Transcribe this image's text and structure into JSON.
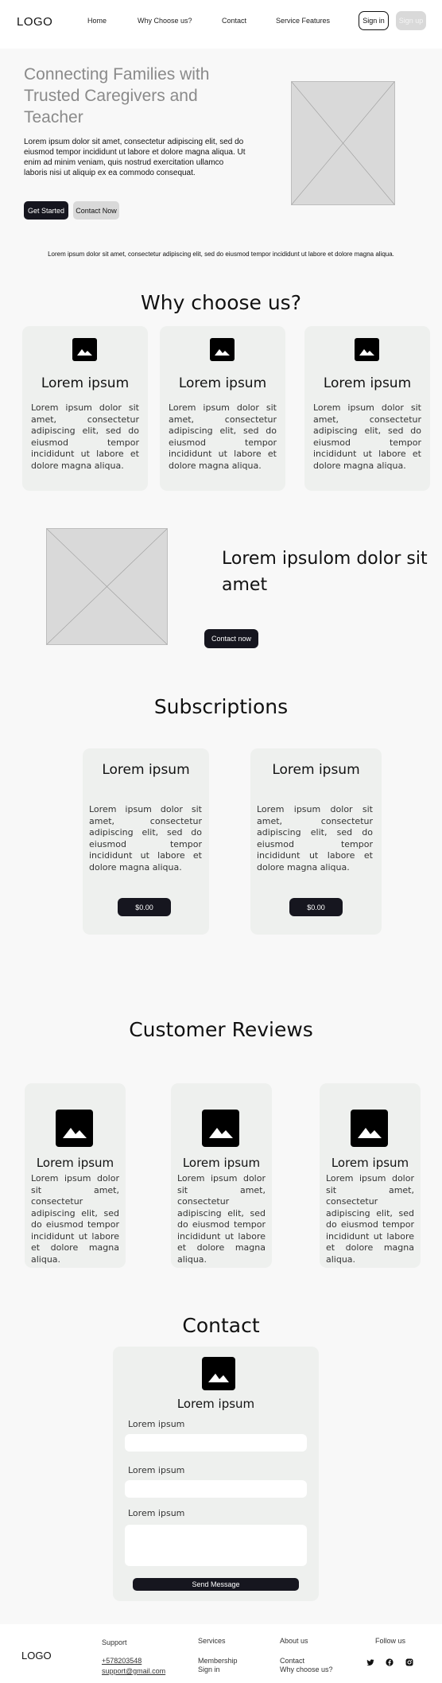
{
  "header": {
    "logo": "LOGO",
    "nav": [
      "Home",
      "Why Choose us?",
      "Contact",
      "Service Features"
    ],
    "signin_label": "Sign in",
    "signup_label": "Sign up"
  },
  "hero": {
    "title": "Connecting Families with Trusted Caregivers and Teacher",
    "text": "Lorem ipsum dolor sit amet, consectetur adipiscing elit, sed do eiusmod tempor incididunt ut labore et dolore magna aliqua. Ut enim ad minim veniam, quis nostrud exercitation ullamco laboris nisi ut aliquip ex ea commodo consequat.",
    "get_started_label": "Get Started",
    "contact_now_label": "Contact Now",
    "caption": "Lorem ipsum dolor sit amet, consectetur adipiscing elit, sed do eiusmod tempor incididunt ut labore et dolore magna aliqua."
  },
  "why": {
    "heading": "Why choose us?",
    "cards": [
      {
        "title": "Lorem ipsum",
        "text": "Lorem ipsum dolor sit amet, consectetur adipiscing elit, sed do eiusmod tempor incididunt ut labore et dolore magna aliqua."
      },
      {
        "title": "Lorem ipsum",
        "text": "Lorem ipsum dolor sit amet, consectetur adipiscing elit, sed do eiusmod tempor incididunt ut labore et dolore magna aliqua."
      },
      {
        "title": "Lorem ipsum",
        "text": "Lorem ipsum dolor sit amet, consectetur adipiscing elit, sed do eiusmod tempor incididunt ut labore et dolore magna aliqua."
      }
    ]
  },
  "feature": {
    "title": "Lorem ipsulom dolor sit amet",
    "button_label": "Contact now"
  },
  "subscriptions": {
    "heading": "Subscriptions",
    "cards": [
      {
        "title": "Lorem ipsum",
        "text": "Lorem ipsum dolor sit amet, consectetur adipiscing elit, sed do eiusmod tempor incididunt ut labore et dolore magna aliqua.",
        "price": "$0.00"
      },
      {
        "title": "Lorem ipsum",
        "text": "Lorem ipsum dolor sit amet, consectetur adipiscing elit, sed do eiusmod tempor incididunt ut labore et dolore magna aliqua.",
        "price": "$0.00"
      }
    ]
  },
  "reviews": {
    "heading": "Customer Reviews",
    "cards": [
      {
        "title": "Lorem ipsum",
        "text": "Lorem ipsum dolor sit amet, consectetur adipiscing elit, sed do eiusmod tempor incididunt ut labore et dolore magna aliqua."
      },
      {
        "title": "Lorem ipsum",
        "text": "Lorem ipsum dolor sit amet, consectetur adipiscing elit, sed do eiusmod tempor incididunt ut labore et dolore magna aliqua."
      },
      {
        "title": "Lorem ipsum",
        "text": "Lorem ipsum dolor sit amet, consectetur adipiscing elit, sed do eiusmod tempor incididunt ut labore et dolore magna aliqua."
      }
    ]
  },
  "contact": {
    "heading": "Contact",
    "subtitle": "Lorem ipsum",
    "fields": [
      {
        "label": "Lorem ipsum",
        "value": ""
      },
      {
        "label": "Lorem ipsum",
        "value": ""
      },
      {
        "label": "Lorem ipsum",
        "value": ""
      }
    ],
    "send_label": "Send Message"
  },
  "footer": {
    "logo": "LOGO",
    "support": {
      "heading": "Support",
      "phone": "+578203548",
      "email": "support@gmail.com"
    },
    "services": {
      "heading": "Services",
      "links": [
        "Membership",
        "Sign in"
      ]
    },
    "about": {
      "heading": "About us",
      "links": [
        "Contact",
        "Why choose us?"
      ]
    },
    "follow": {
      "heading": "Follow us",
      "icons": [
        "twitter-icon",
        "facebook-icon",
        "instagram-icon"
      ]
    }
  },
  "colors": {
    "primary_dark": "#16161f",
    "card_bg": "#eef0ee",
    "placeholder": "#d9d9d9",
    "page_bg": "#f8f8f8"
  }
}
